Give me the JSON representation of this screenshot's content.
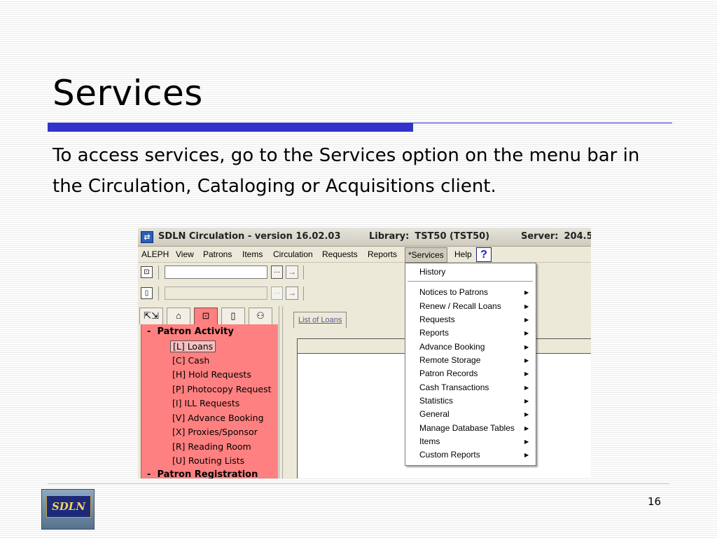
{
  "slide": {
    "title": "Services",
    "body": "To access services, go to the Services option on the menu bar in the Circulation, Cataloging or Acquisitions client.",
    "page_number": "16"
  },
  "window": {
    "title": "SDLN Circulation - version 16.02.03",
    "library_label": "Library:",
    "library_value": "TST50 (TST50)",
    "server_label": "Server:",
    "server_value": "204.5"
  },
  "menubar": [
    "ALEPH",
    "View",
    "Patrons",
    "Items",
    "Circulation",
    "Requests",
    "Reports",
    "*Services",
    "Help"
  ],
  "help_glyph": "?",
  "toolbar": {
    "browse_glyph": "···",
    "go_glyph": "→"
  },
  "left_tabs": [
    "⇱⇲",
    "⌂",
    "⊡",
    "▯",
    "⚇"
  ],
  "tree": {
    "header": "Patron Activity",
    "items": [
      "[L] Loans",
      "[C] Cash",
      "[H] Hold Requests",
      "[P] Photocopy Request",
      "[I] ILL Requests",
      "[V] Advance Booking",
      "[X] Proxies/Sponsor",
      "[R] Reading Room",
      "[U] Routing Lists"
    ],
    "footer_header": "Patron Registration",
    "collapse_glyph": "-"
  },
  "right_tab": "List of Loans",
  "services_menu": {
    "first": "History",
    "items": [
      "Notices to Patrons",
      "Renew / Recall Loans",
      "Requests",
      "Reports",
      "Advance Booking",
      "Remote Storage",
      "Patron Records",
      "Cash Transactions",
      "Statistics",
      "General",
      "Manage Database Tables",
      "Items",
      "Custom Reports"
    ]
  },
  "logo_text": "SDLN",
  "colors": {
    "title_bar": "#3333cc",
    "patron_panel": "#ff8080",
    "window_face": "#ece9d8"
  }
}
